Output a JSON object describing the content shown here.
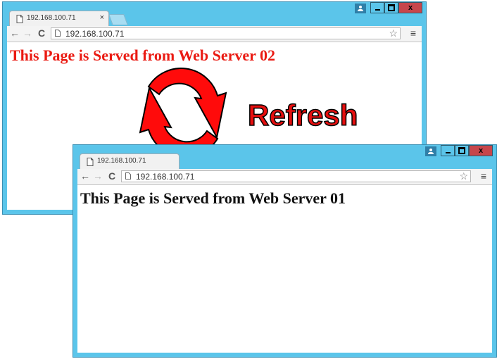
{
  "back_window": {
    "tab_title": "192.168.100.71",
    "tab_close": "×",
    "url": "192.168.100.71",
    "heading": "This Page is Served from Web Server 02",
    "heading_color": "#ea1a12"
  },
  "refresh_overlay": {
    "label": "Refresh",
    "color": "#e60f0f"
  },
  "front_window": {
    "tab_title": "192.168.100.71",
    "url": "192.168.100.71",
    "heading": "This Page is Served from Web Server 01",
    "heading_color": "#111111"
  },
  "chrome": {
    "titlebar_color": "#5bc5ea",
    "close_color": "#c7464c",
    "back_arrow": "←",
    "forward_arrow": "→",
    "reload": "C",
    "star": "☆",
    "menu": "≡",
    "close_glyph": "x",
    "icons": [
      "page-icon",
      "user-icon",
      "star-icon",
      "menu-icon"
    ]
  }
}
